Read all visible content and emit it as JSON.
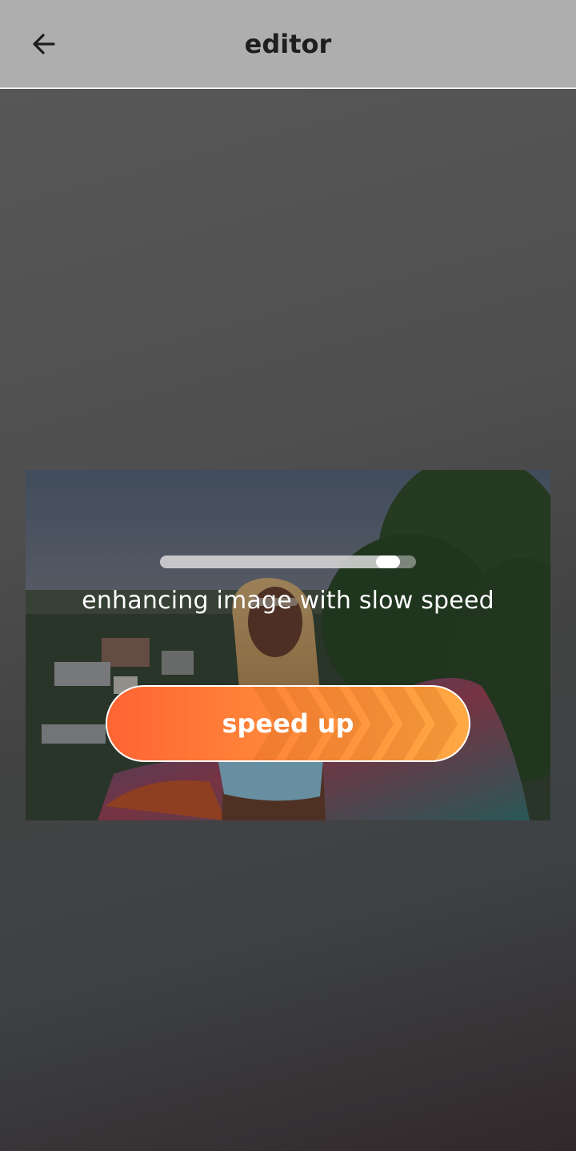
{
  "header": {
    "title": "editor",
    "back_icon": "arrow-left-icon"
  },
  "editor": {
    "status_text": "enhancing image with slow speed",
    "progress": 0.93,
    "speed_up_label": "speed up",
    "speed_up_gradient": [
      "#ff6433",
      "#ffa944"
    ]
  },
  "colors": {
    "header_bg": "#aeaeae",
    "title_color": "#1e1e1e",
    "accent": "#ff7a36"
  }
}
